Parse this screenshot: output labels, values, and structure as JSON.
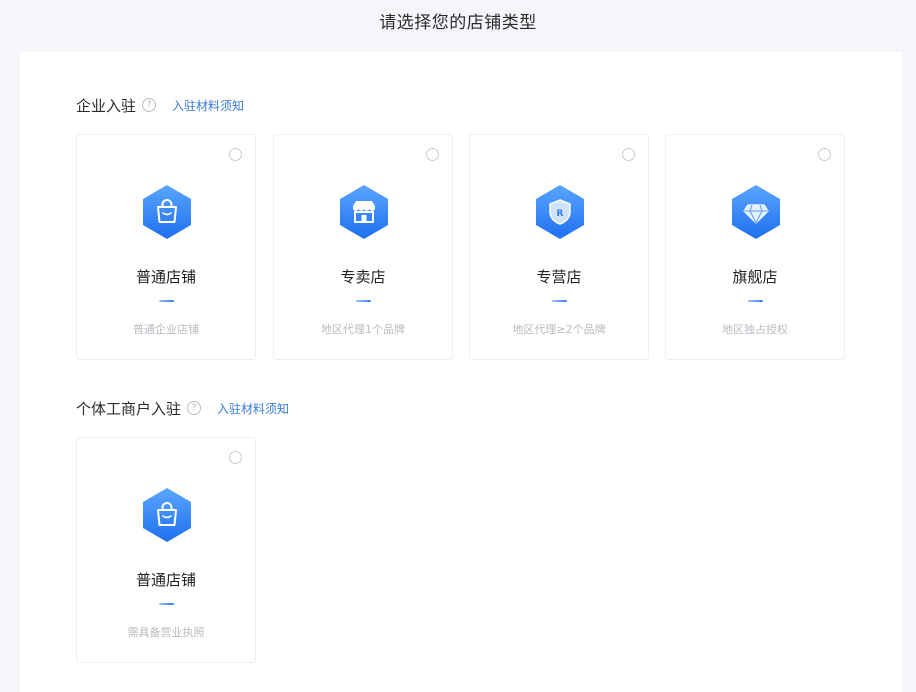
{
  "page": {
    "title": "请选择您的店铺类型"
  },
  "colors": {
    "accent": "#3a7bd5",
    "icon_gradient_top": "#5aa6ff",
    "icon_gradient_bottom": "#1f6ff0"
  },
  "sections": [
    {
      "title": "企业入驻",
      "help_icon": "question-circle-icon",
      "notice_link": "入驻材料须知",
      "cards": [
        {
          "name": "普通店铺",
          "desc": "普通企业店铺",
          "icon": "shopping-bag-icon",
          "selected": false
        },
        {
          "name": "专卖店",
          "desc": "地区代理1个品牌",
          "icon": "storefront-icon",
          "selected": false
        },
        {
          "name": "专营店",
          "desc": "地区代理≥2个品牌",
          "icon": "shield-r-icon",
          "selected": false
        },
        {
          "name": "旗舰店",
          "desc": "地区独占授权",
          "icon": "diamond-icon",
          "selected": false
        }
      ]
    },
    {
      "title": "个体工商户入驻",
      "help_icon": "question-circle-icon",
      "notice_link": "入驻材料须知",
      "cards": [
        {
          "name": "普通店铺",
          "desc": "需具备营业执照",
          "icon": "shopping-bag-icon",
          "selected": false
        }
      ]
    }
  ]
}
